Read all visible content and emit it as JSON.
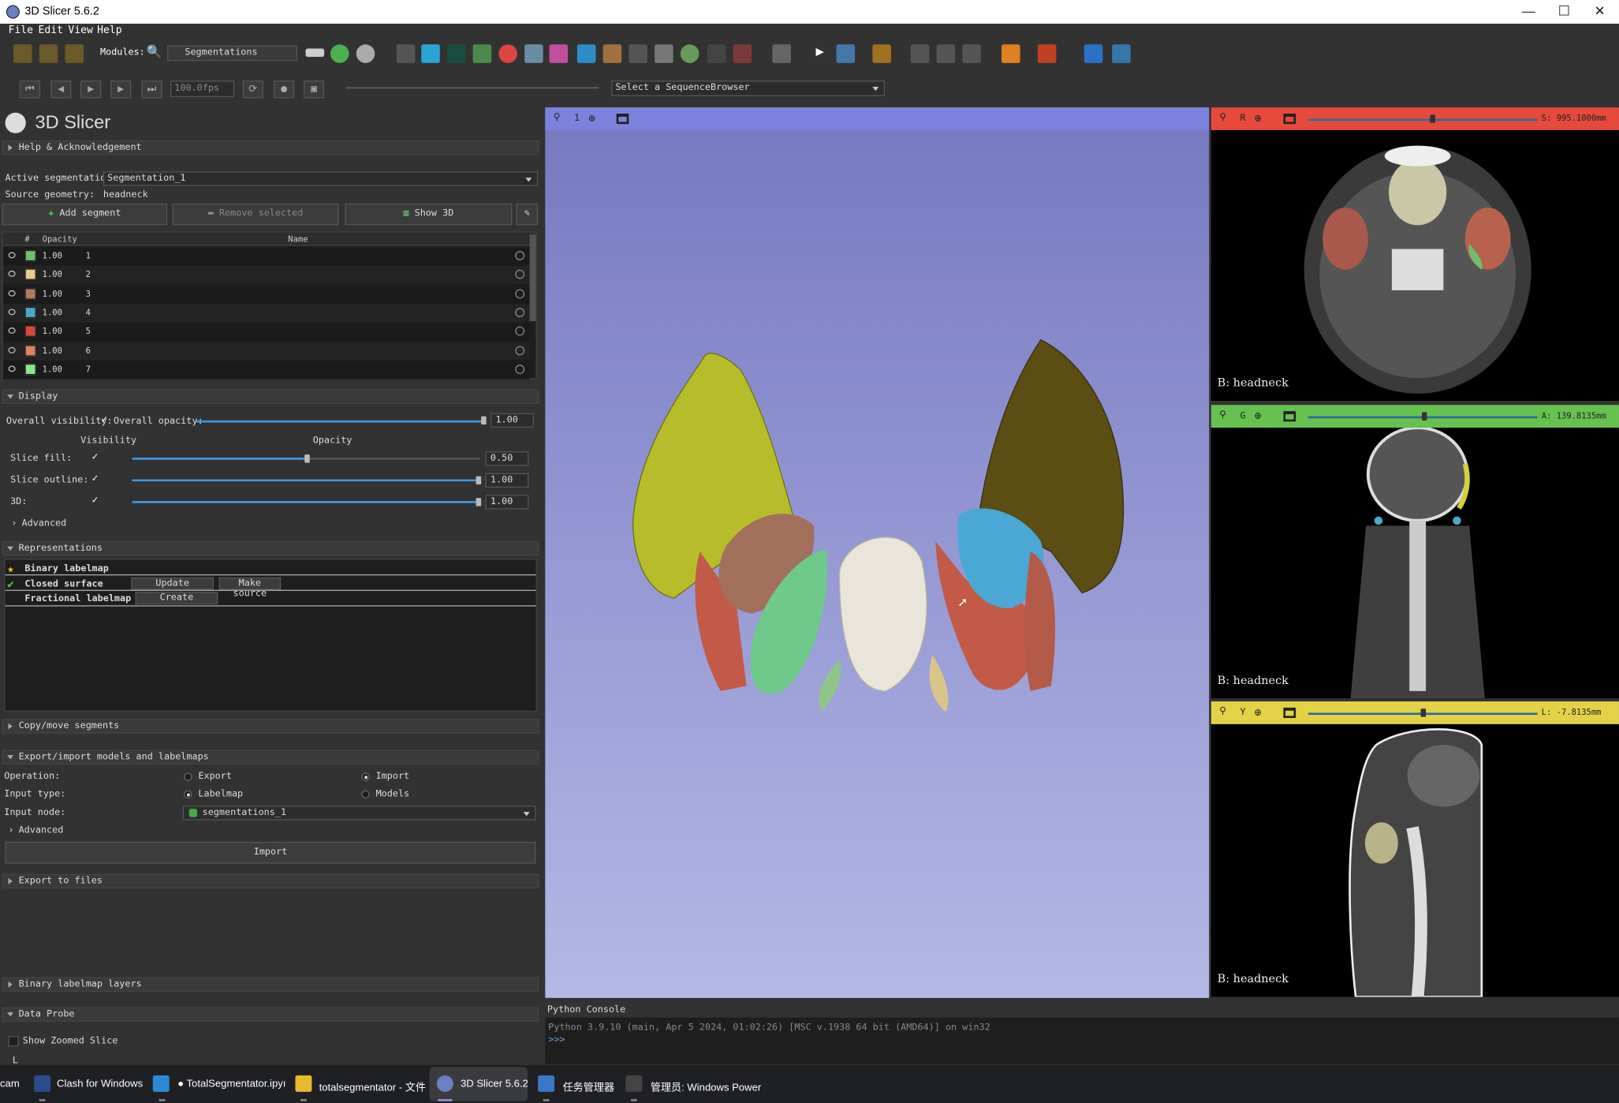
{
  "window": {
    "title": "3D Slicer 5.6.2",
    "controls": [
      "—",
      "☐",
      "✕"
    ]
  },
  "menu": [
    "File",
    "Edit",
    "View",
    "Help"
  ],
  "toolbar": {
    "modules_label": "Modules:",
    "module": "Segmentations"
  },
  "sequence": {
    "fps": "100.0fps",
    "browser": "Select a SequenceBrowser"
  },
  "panel": {
    "logo_text": "3D Slicer",
    "help": "Help & Acknowledgement",
    "active_seg_label": "Active segmentation:",
    "active_seg": "Segmentation_1",
    "source_geom_label": "Source geometry:",
    "source_geom": "headneck",
    "add_segment": "Add segment",
    "remove_selected": "Remove selected",
    "show3d": "Show 3D",
    "table_header": {
      "opacity": "Opacity",
      "name": "Name",
      "hash": "#"
    },
    "segments": [
      {
        "opacity": "1.00",
        "name": "1",
        "color": "#6fbf6e"
      },
      {
        "opacity": "1.00",
        "name": "2",
        "color": "#e6cd8a"
      },
      {
        "opacity": "1.00",
        "name": "3",
        "color": "#b07a63"
      },
      {
        "opacity": "1.00",
        "name": "4",
        "color": "#4fa6c9"
      },
      {
        "opacity": "1.00",
        "name": "5",
        "color": "#d64a3c"
      },
      {
        "opacity": "1.00",
        "name": "6",
        "color": "#dd8263"
      },
      {
        "opacity": "1.00",
        "name": "7",
        "color": "#8ee68a"
      }
    ],
    "display": {
      "title": "Display",
      "overall_visibility": "Overall visibility:",
      "overall_opacity": "Overall opacity:",
      "overall_opacity_val": "1.00",
      "vis_hdr": "Visibility",
      "op_hdr": "Opacity",
      "slice_fill": "Slice fill:",
      "slice_fill_val": "0.50",
      "slice_fill_level": 0.5,
      "slice_outline": "Slice outline:",
      "slice_outline_val": "1.00",
      "threed": "3D:",
      "threed_val": "1.00",
      "advanced": "Advanced"
    },
    "representations": {
      "title": "Representations",
      "binary": "Binary labelmap",
      "closed": "Closed surface",
      "update": "Update",
      "make_source": "Make source",
      "fractional": "Fractional labelmap",
      "create": "Create"
    },
    "copymove": "Copy/move segments",
    "exportimport": {
      "title": "Export/import models and labelmaps",
      "operation": "Operation:",
      "export": "Export",
      "import": "Import",
      "input_type": "Input type:",
      "labelmap": "Labelmap",
      "models": "Models",
      "input_node": "Input node:",
      "node": "segmentations_1",
      "advanced": "Advanced",
      "import_btn": "Import"
    },
    "export_files": "Export to files",
    "binary_layers": "Binary labelmap layers",
    "data_probe": "Data Probe",
    "show_zoomed": "Show Zoomed Slice",
    "probe_L": "L"
  },
  "view3d": {
    "layout_num": "1"
  },
  "slices": [
    {
      "letter": "R",
      "offset": "S: 995.1000mm",
      "bar_color": "#e64a3c",
      "label": "B: headneck"
    },
    {
      "letter": "G",
      "offset": "A: 139.8135mm",
      "bar_color": "#66c150",
      "label": "B: headneck"
    },
    {
      "letter": "Y",
      "offset": "L: -7.8135mm",
      "bar_color": "#e3d247",
      "label": "B: headneck"
    }
  ],
  "console": {
    "title": "Python Console",
    "line1": "Python 3.9.10 (main, Apr  5 2024, 01:02:26) [MSC v.1938 64 bit (AMD64)] on win32",
    "prompt": ">>>"
  },
  "taskbar": [
    {
      "label": "cam"
    },
    {
      "label": "Clash for Windows"
    },
    {
      "label": "● TotalSegmentator.ipyı"
    },
    {
      "label": "totalsegmentator - 文件"
    },
    {
      "label": "3D Slicer 5.6.2"
    },
    {
      "label": "任务管理器"
    },
    {
      "label": "管理员: Windows Power"
    }
  ]
}
